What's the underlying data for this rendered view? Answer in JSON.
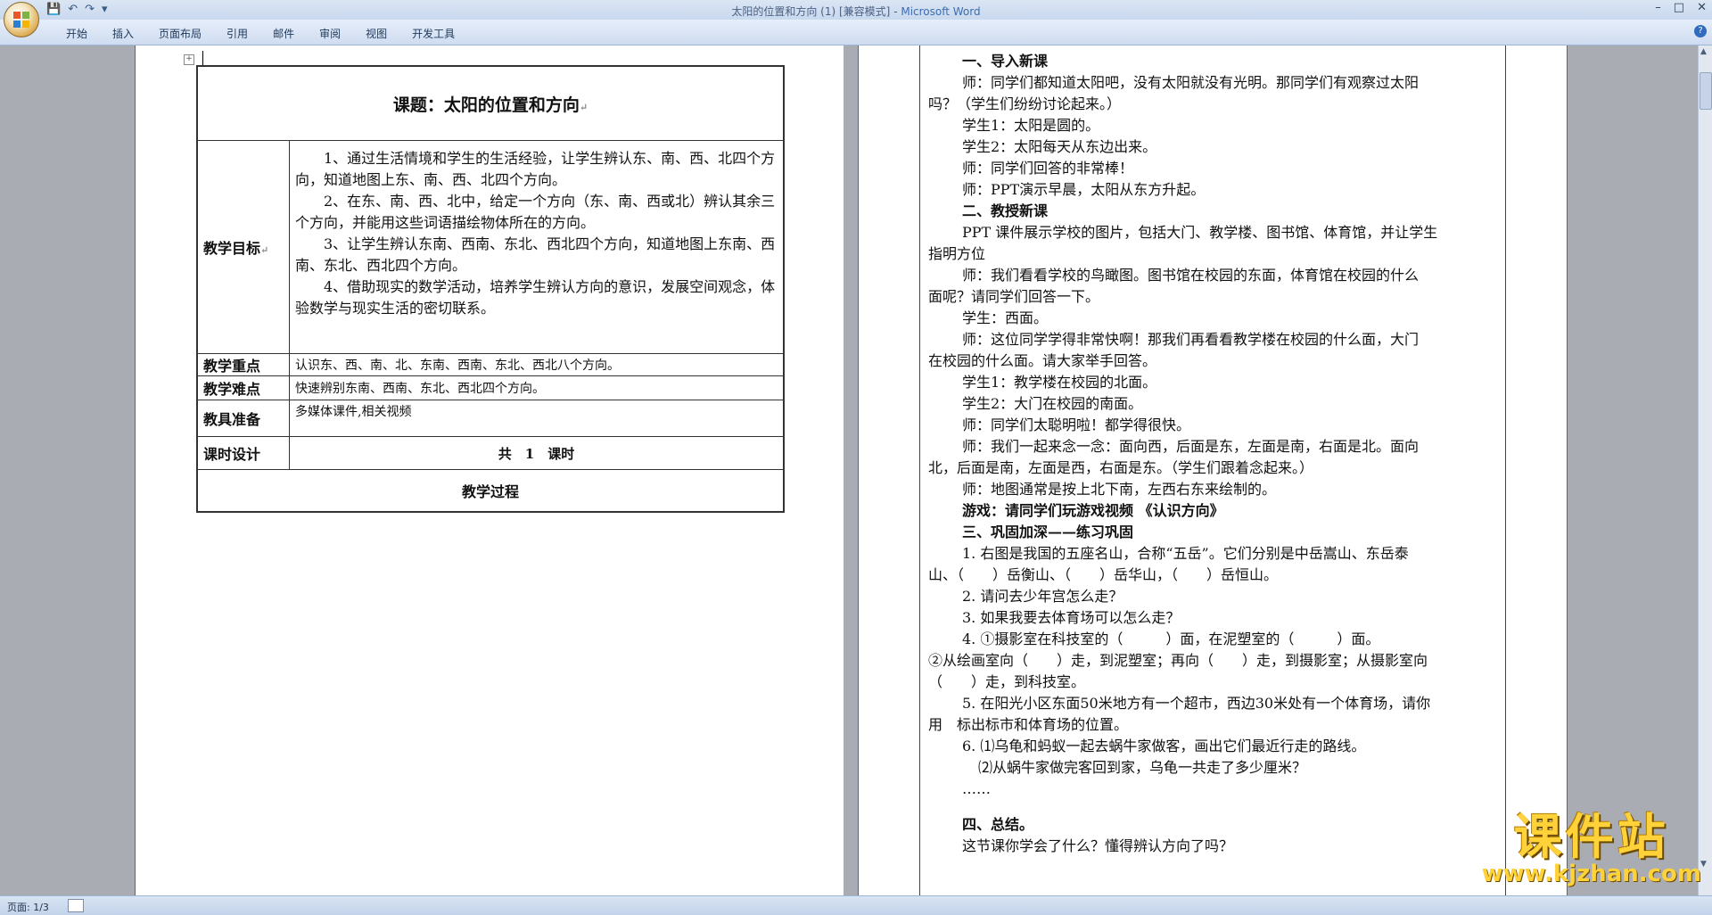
{
  "window": {
    "title": "太阳的位置和方向 (1) [兼容模式]",
    "app_name": "Microsoft Word"
  },
  "qat": {
    "save": "💾",
    "undo": "↶",
    "redo": "↷",
    "more": "▾"
  },
  "controls": {
    "minimize": "–",
    "maximize": "□",
    "close": "✕"
  },
  "ribbon": {
    "tabs": [
      "开始",
      "插入",
      "页面布局",
      "引用",
      "邮件",
      "审阅",
      "视图",
      "开发工具"
    ],
    "help": "?"
  },
  "page1": {
    "title": "课题：太阳的位置和方向",
    "rows": {
      "goals_label": "教学目标",
      "goals": [
        "1、通过生活情境和学生的生活经验，让学生辨认东、南、西、北四个方向，知道地图上东、南、西、北四个方向。",
        "2、在东、南、西、北中，给定一个方向（东、南、西或北）辨认其余三个方向，并能用这些词语描绘物体所在的方向。",
        "3、让学生辨认东南、西南、东北、西北四个方向，知道地图上东南、西南、东北、西北四个方向。",
        "4、借助现实的数学活动，培养学生辨认方向的意识，发展空间观念，体验数学与现实生活的密切联系。"
      ],
      "key_label": "教学重点",
      "key_value": "认识东、西、南、北、东南、西南、东北、西北八个方向。",
      "difficult_label": "教学难点",
      "difficult_value": "快速辨别东南、西南、东北、西北四个方向。",
      "prep_label": "教具准备",
      "prep_value": "多媒体课件,相关视频",
      "time_label": "课时设计",
      "time_value": "共　1　课时",
      "process": "教学过程"
    }
  },
  "page2": {
    "lines": [
      {
        "t": "一、导入新课",
        "style": "b ind"
      },
      {
        "t": "师：同学们都知道太阳吧，没有太阳就没有光明。那同学们有观察过太阳",
        "style": "ind"
      },
      {
        "t": "吗？（学生们纷纷讨论起来。）",
        "style": ""
      },
      {
        "t": "学生1：太阳是圆的。",
        "style": "ind"
      },
      {
        "t": "学生2：太阳每天从东边出来。",
        "style": "ind"
      },
      {
        "t": "师：同学们回答的非常棒！",
        "style": "ind"
      },
      {
        "t": "师：PPT演示早晨，太阳从东方升起。",
        "style": "ind"
      },
      {
        "t": "二、教授新课",
        "style": "b ind"
      },
      {
        "t": "PPT 课件展示学校的图片，包括大门、教学楼、图书馆、体育馆，并让学生",
        "style": "ind"
      },
      {
        "t": "指明方位",
        "style": ""
      },
      {
        "t": "师：我们看看学校的鸟瞰图。图书馆在校园的东面，体育馆在校园的什么",
        "style": "ind"
      },
      {
        "t": "面呢？请同学们回答一下。",
        "style": ""
      },
      {
        "t": "学生：西面。",
        "style": "ind"
      },
      {
        "t": "师：这位同学学得非常快啊！那我们再看看教学楼在校园的什么面，大门",
        "style": "ind"
      },
      {
        "t": "在校园的什么面。请大家举手回答。",
        "style": ""
      },
      {
        "t": "学生1：教学楼在校园的北面。",
        "style": "ind"
      },
      {
        "t": "学生2：大门在校园的南面。",
        "style": "ind"
      },
      {
        "t": "师：同学们太聪明啦！都学得很快。",
        "style": "ind"
      },
      {
        "t": "师：我们一起来念一念：面向西，后面是东，左面是南，右面是北。面向",
        "style": "ind"
      },
      {
        "t": "北，后面是南，左面是西，右面是东。（学生们跟着念起来。）",
        "style": ""
      },
      {
        "t": "师：地图通常是按上北下南，左西右东来绘制的。",
        "style": "ind"
      },
      {
        "t": "游戏：请同学们玩游戏视频 《认识方向》",
        "style": "b ind"
      },
      {
        "t": "三、巩固加深——练习巩固",
        "style": "b ind"
      },
      {
        "t": "1. 右图是我国的五座名山，合称“五岳”。它们分别是中岳嵩山、东岳泰",
        "style": "ind"
      },
      {
        "t": "山、（　　）岳衡山、（　　）岳华山，（　　）岳恒山。",
        "style": ""
      },
      {
        "t": "2. 请问去少年宫怎么走？",
        "style": "ind"
      },
      {
        "t": "3. 如果我要去体育场可以怎么走？",
        "style": "ind"
      },
      {
        "t": "4. ①摄影室在科技室的（　　　）面，在泥塑室的（　　　）面。",
        "style": "ind"
      },
      {
        "t": "②从绘画室向（　　）走，到泥塑室；再向（　　）走，到摄影室；从摄影室向",
        "style": ""
      },
      {
        "t": "（　　）走，到科技室。",
        "style": ""
      },
      {
        "t": "5. 在阳光小区东面50米地方有一个超市，西边30米处有一个体育场，请你",
        "style": "ind"
      },
      {
        "t": "用　标出标市和体育场的位置。",
        "style": ""
      },
      {
        "t": "6. ⑴乌龟和蚂蚁一起去蜗牛家做客，画出它们最近行走的路线。",
        "style": "ind"
      },
      {
        "t": "⑵从蜗牛家做完客回到家，乌龟一共走了多少厘米？",
        "style": "ind2"
      },
      {
        "t": "……",
        "style": "ind"
      },
      {
        "t": "",
        "style": "gap"
      },
      {
        "t": "四、总结。",
        "style": "b ind"
      },
      {
        "t": "这节课你学会了什么？懂得辨认方向了吗？",
        "style": "ind"
      }
    ]
  },
  "status": {
    "page": "页面: 1/3"
  },
  "watermark": {
    "brand": "课件站",
    "url": "www.kjzhan.com"
  }
}
